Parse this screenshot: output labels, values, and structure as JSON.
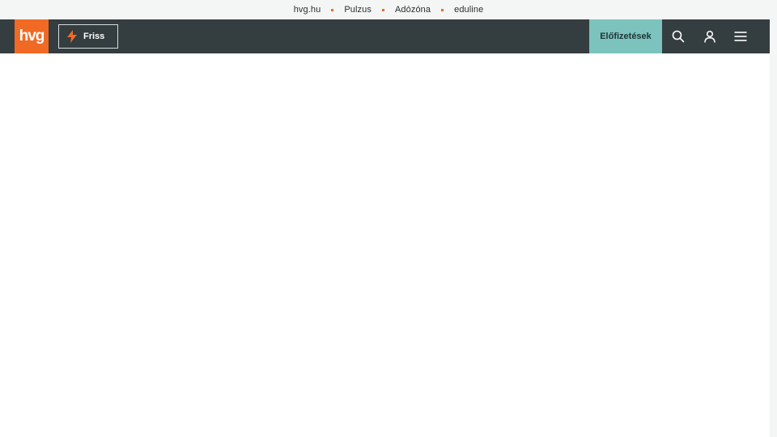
{
  "topbar": {
    "links": [
      "hvg.hu",
      "Pulzus",
      "Adózóna",
      "eduline"
    ]
  },
  "navbar": {
    "logo_text": "hvg",
    "friss_label": "Friss",
    "subscribe_label": "Előfizetések",
    "icons": [
      "search-icon",
      "user-icon",
      "hamburger-menu-icon"
    ]
  },
  "colors": {
    "brand_orange": "#f06a25",
    "navbar_bg": "#343d3f",
    "subscribe_bg": "#7cc3bd"
  }
}
